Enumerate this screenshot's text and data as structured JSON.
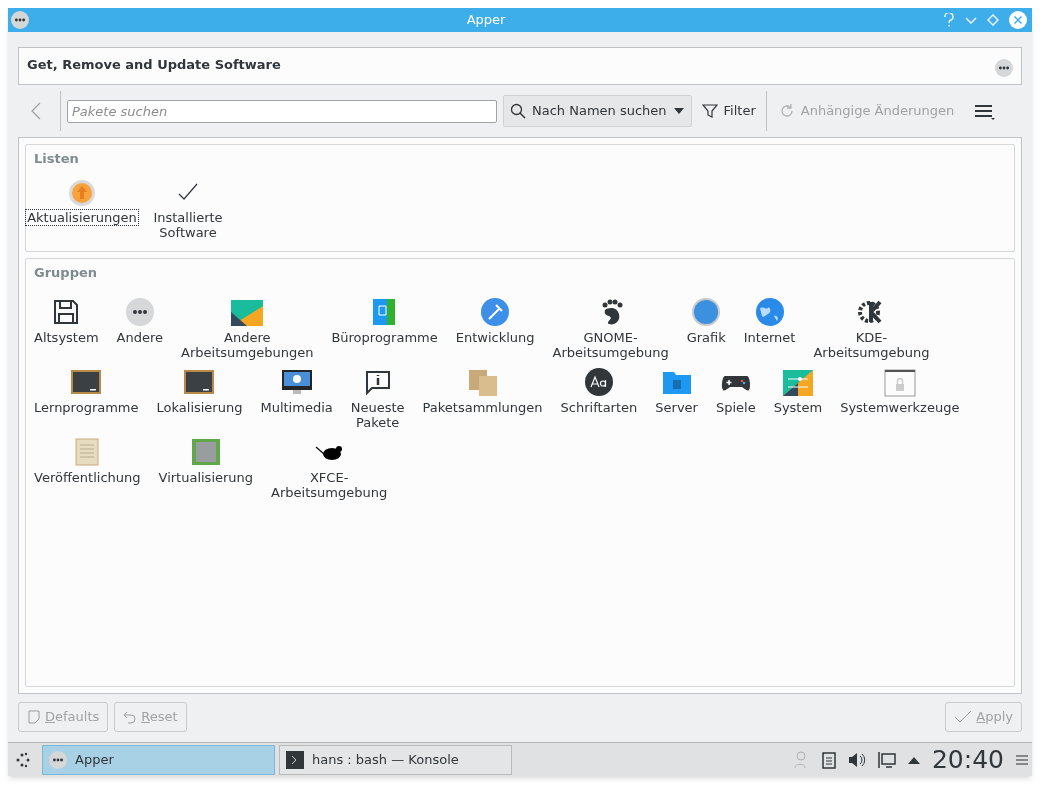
{
  "window": {
    "title": "Apper"
  },
  "header": {
    "title": "Get, Remove and Update Software"
  },
  "toolbar": {
    "search": {
      "placeholder": "Pakete suchen"
    },
    "search_mode": "Nach Namen suchen",
    "filter": "Filter",
    "pending": {
      "label": "Anhängige Änderungen",
      "disabled": true
    }
  },
  "lists": {
    "title": "Listen",
    "items": [
      {
        "label": "Aktualisierungen",
        "selected": true
      },
      {
        "label": "Installierte Software",
        "selected": false
      }
    ]
  },
  "groups": {
    "title": "Gruppen",
    "rows": [
      [
        {
          "label": "Altsystem"
        },
        {
          "label": "Andere"
        },
        {
          "label": "Andere Arbeitsumgebungen"
        },
        {
          "label": "Büroprogramme"
        },
        {
          "label": "Entwicklung"
        },
        {
          "label": "GNOME-Arbeitsumgebung"
        },
        {
          "label": "Grafik"
        },
        {
          "label": "Internet"
        },
        {
          "label": "KDE-Arbeitsumgebung"
        }
      ],
      [
        {
          "label": "Lernprogramme"
        },
        {
          "label": "Lokalisierung"
        },
        {
          "label": "Multimedia"
        },
        {
          "label": "Neueste Pakete"
        },
        {
          "label": "Paketsammlungen"
        },
        {
          "label": "Schriftarten"
        },
        {
          "label": "Server"
        },
        {
          "label": "Spiele"
        },
        {
          "label": "System"
        },
        {
          "label": "Systemwerkzeuge"
        }
      ],
      [
        {
          "label": "Veröffentlichung"
        },
        {
          "label": "Virtualisierung"
        },
        {
          "label": "XFCE-Arbeitsumgebung"
        }
      ]
    ]
  },
  "buttons": [
    {
      "label": "Defaults",
      "disabled": true
    },
    {
      "label": "Reset",
      "disabled": true
    },
    {
      "label": "Apply",
      "disabled": true
    }
  ],
  "taskbar": {
    "tasks": [
      {
        "label": "Apper",
        "selected": true
      },
      {
        "label": "hans : bash — Konsole",
        "selected": false
      }
    ],
    "clock": "20:40"
  }
}
